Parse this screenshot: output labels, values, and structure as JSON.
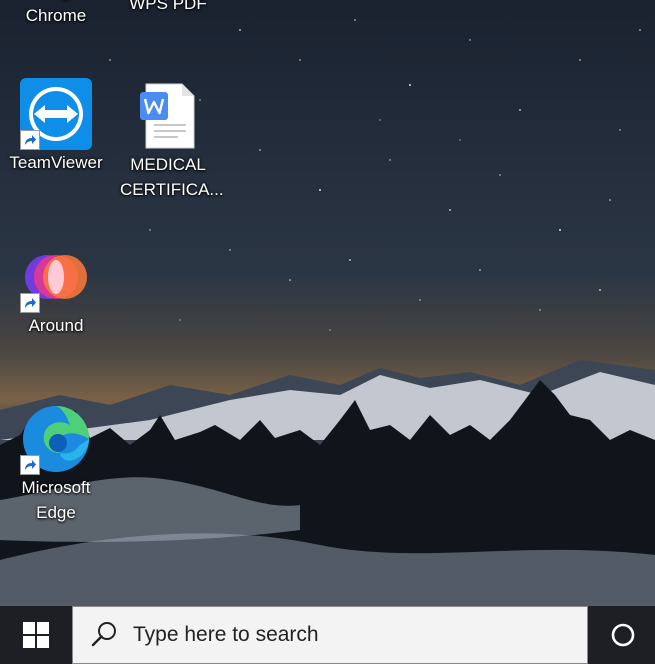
{
  "desktop": {
    "icons": [
      {
        "label": "Google\nChrome",
        "icon": "chrome-icon"
      },
      {
        "label": "WPS PDF",
        "icon": "wps-pdf-icon"
      },
      {
        "label": "TeamViewer",
        "icon": "teamviewer-icon"
      },
      {
        "label": "MEDICAL\nCERTIFICA...",
        "icon": "word-document-icon"
      },
      {
        "label": "Around",
        "icon": "around-icon"
      },
      {
        "label": "Microsoft\nEdge",
        "icon": "edge-icon"
      }
    ]
  },
  "taskbar": {
    "search_placeholder": "Type here to search",
    "start_icon": "windows-logo-icon",
    "cortana_icon": "cortana-icon"
  },
  "colors": {
    "taskbar": "#1d1f24",
    "search_box": "#f3f3f3",
    "teamviewer": "#0e8ee9",
    "word_blue": "#4a8cf0"
  }
}
